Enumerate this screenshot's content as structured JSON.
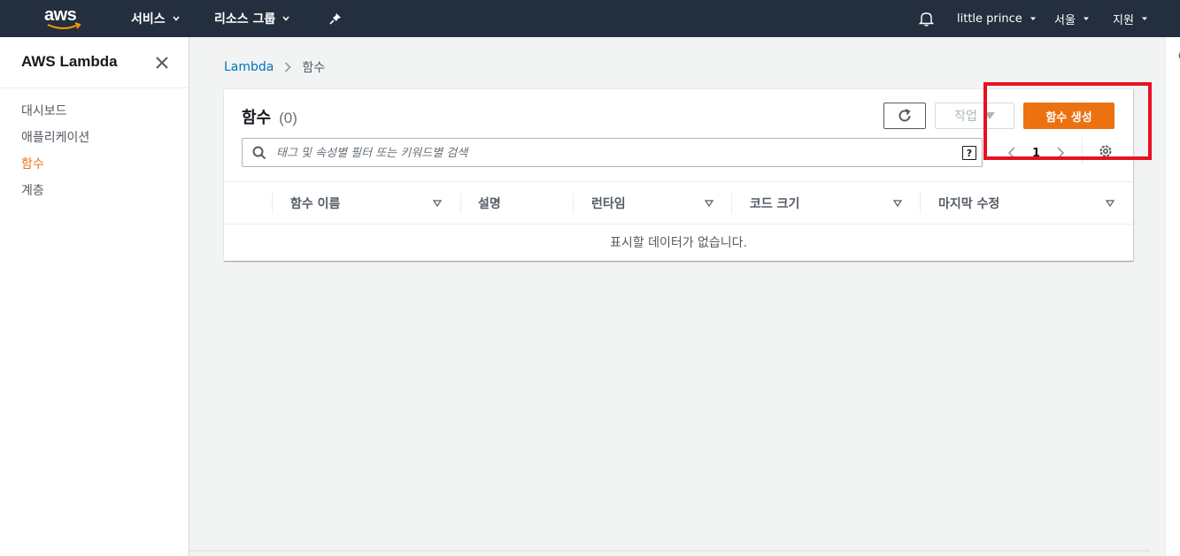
{
  "topnav": {
    "logo_text": "aws",
    "services": "서비스",
    "resource_groups": "리소스 그룹",
    "user": "little prince",
    "region": "서울",
    "support": "지원"
  },
  "sidebar": {
    "title": "AWS Lambda",
    "items": [
      {
        "label": "대시보드"
      },
      {
        "label": "애플리케이션"
      },
      {
        "label": "함수"
      },
      {
        "label": "계층"
      }
    ]
  },
  "breadcrumb": {
    "root": "Lambda",
    "current": "함수"
  },
  "panel": {
    "title": "함수",
    "count": "(0)",
    "action_label": "작업",
    "create_label": "함수 생성",
    "search_placeholder": "태그 및 속성별 필터 또는 키워드별 검색",
    "help_label": "?",
    "page": "1",
    "columns": [
      "함수 이름",
      "설명",
      "런타임",
      "코드 크기",
      "마지막 수정"
    ],
    "empty_message": "표시할 데이터가 없습니다."
  },
  "colors": {
    "nav_bg": "#232f3e",
    "primary": "#ec7211",
    "link": "#0073bb",
    "highlight": "#e81123"
  },
  "icons": [
    "bell-icon",
    "pin-icon",
    "close-icon",
    "refresh-icon",
    "search-icon",
    "help-icon",
    "chevron-left-icon",
    "chevron-right-icon",
    "gear-icon",
    "sort-icon"
  ]
}
